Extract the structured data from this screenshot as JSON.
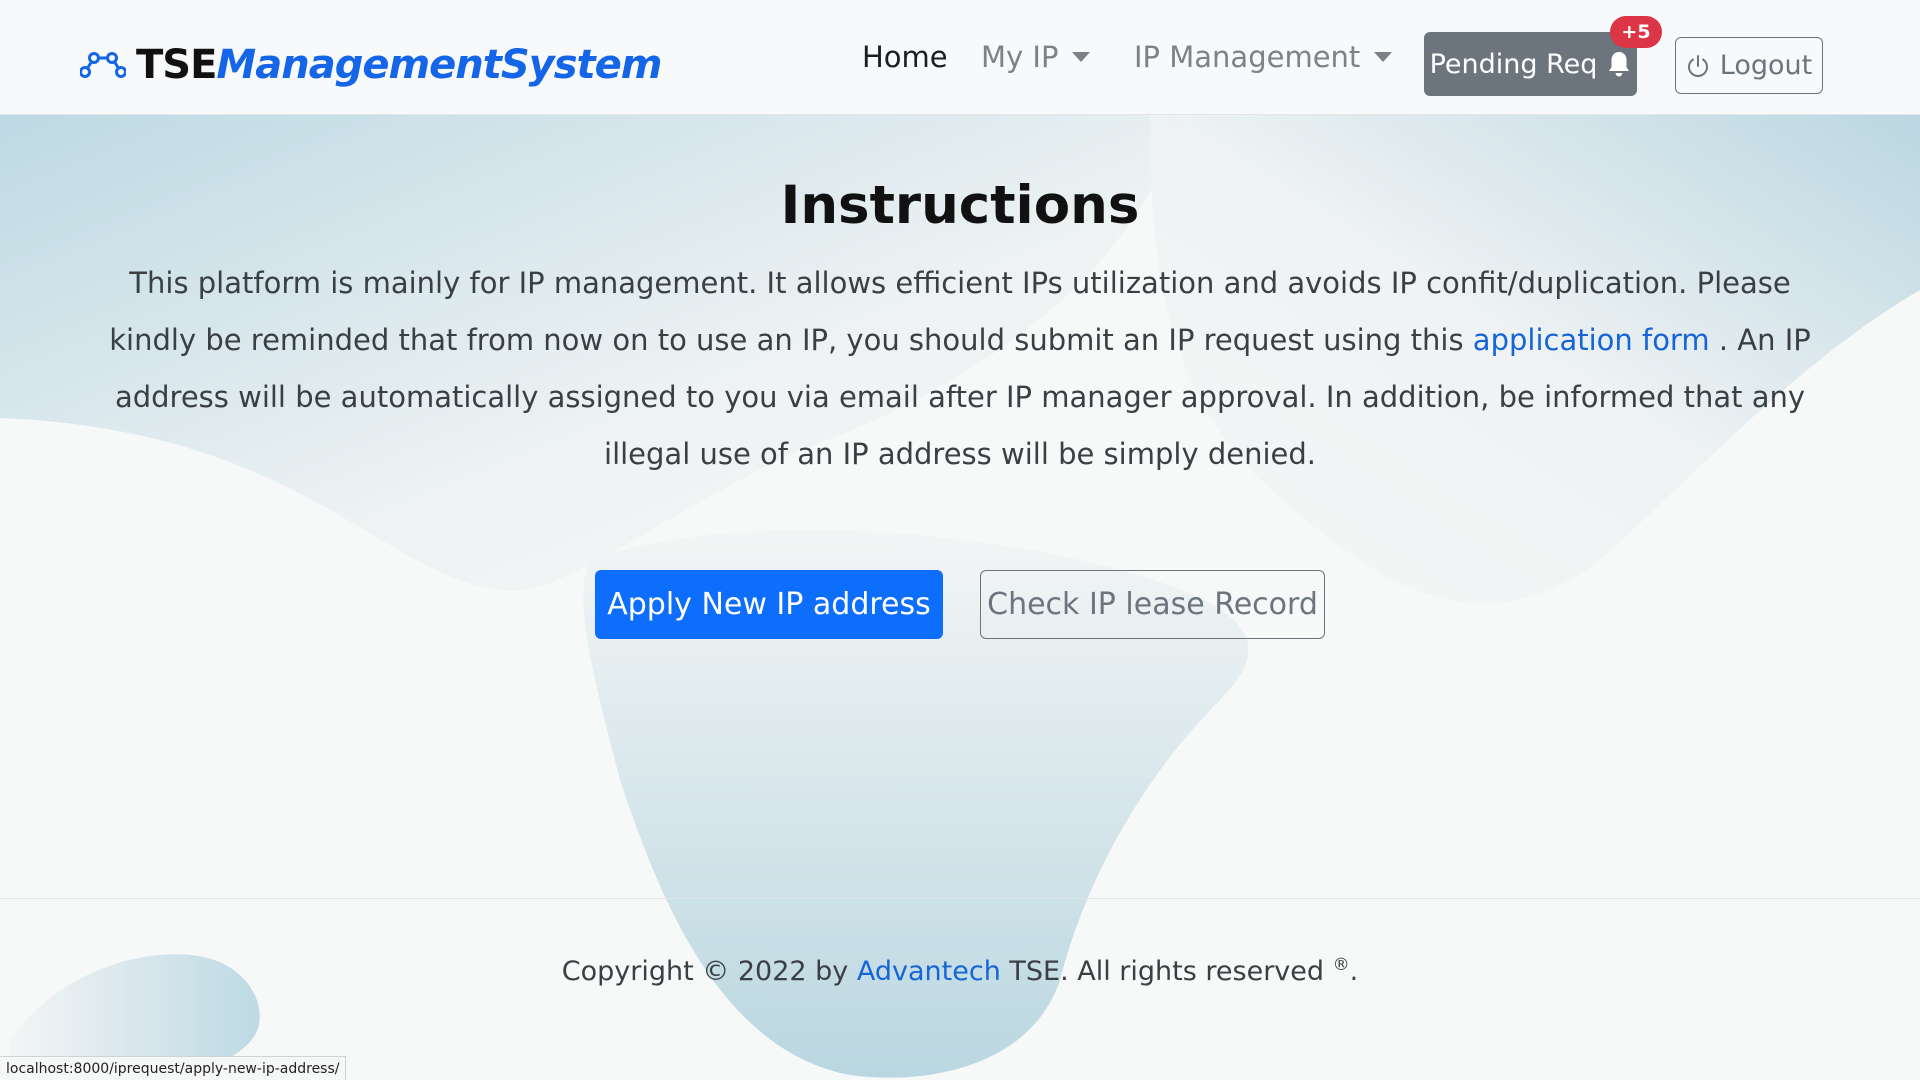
{
  "brand": {
    "name_part1": "TSE",
    "name_part2": "ManagementSystem"
  },
  "nav": {
    "home": "Home",
    "my_ip": "My IP",
    "ip_management": "IP Management"
  },
  "pending": {
    "label": "Pending Req",
    "badge": "+5"
  },
  "logout": {
    "label": "Logout"
  },
  "main": {
    "title": "Instructions",
    "text_before_link": "This platform is mainly for IP management. It allows efficient IPs utilization and avoids IP confit/duplication. Please kindly be reminded that from now on to use an IP, you should submit an IP request using this ",
    "link_text": "application form",
    "text_after_link": " . An IP address will be automatically assigned to you via email after IP manager approval. In addition, be informed that any illegal use of an IP address will be simply denied.",
    "apply_button": "Apply New IP address",
    "check_button": "Check IP lease Record"
  },
  "footer": {
    "prefix": "Copyright © 2022 by ",
    "company": "Advantech",
    "suffix": " TSE. All rights reserved ",
    "registered": "®",
    "end": "."
  },
  "statusbar": {
    "url": "localhost:8000/iprequest/apply-new-ip-address/"
  },
  "colors": {
    "primary": "#0d6efd",
    "secondary": "#6c757d",
    "danger": "#dc3545",
    "brand_blue": "#1565e8",
    "link": "#1565d8",
    "blob": "#b9d7e2"
  }
}
